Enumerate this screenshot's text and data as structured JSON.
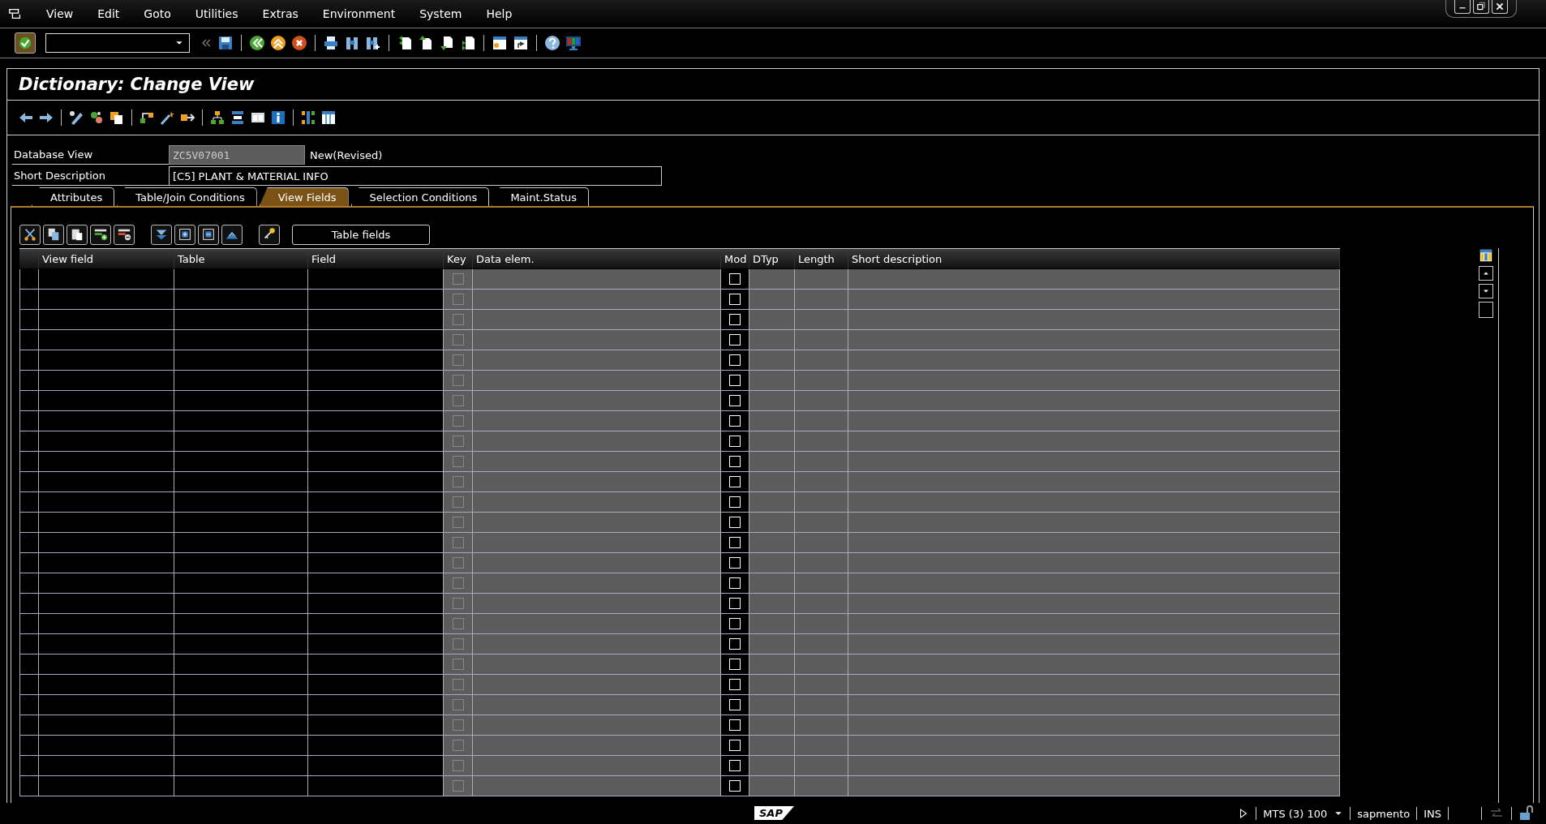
{
  "menu": [
    "View",
    "Edit",
    "Goto",
    "Utilities",
    "Extras",
    "Environment",
    "System",
    "Help"
  ],
  "title": "Dictionary: Change View",
  "fields": [
    {
      "label": "Database View",
      "value": "ZC5V07001",
      "kind": "readonly",
      "status": "New(Revised)"
    },
    {
      "label": "Short Description",
      "value": "[C5] PLANT & MATERIAL INFO",
      "kind": "input"
    }
  ],
  "tabs": [
    {
      "label": "Attributes",
      "selected": false
    },
    {
      "label": "Table/Join Conditions",
      "selected": false
    },
    {
      "label": "View Fields",
      "selected": true
    },
    {
      "label": "Selection Conditions",
      "selected": false
    },
    {
      "label": "Maint.Status",
      "selected": false
    }
  ],
  "table_toolbar": {
    "button": "Table fields"
  },
  "table": {
    "columns": [
      {
        "label": "View field",
        "editable": true
      },
      {
        "label": "Table",
        "editable": true
      },
      {
        "label": "Field",
        "editable": true
      },
      {
        "label": "Key",
        "editable": false,
        "kind": "checkbox"
      },
      {
        "label": "Data elem.",
        "editable": false
      },
      {
        "label": "Mod",
        "editable": true,
        "kind": "checkbox"
      },
      {
        "label": "DTyp",
        "editable": false
      },
      {
        "label": "Length",
        "editable": false
      },
      {
        "label": "Short description",
        "editable": false
      }
    ],
    "rows": [
      {
        "key_checked": false,
        "mod_checked": false
      },
      {
        "key_checked": false,
        "mod_checked": false
      },
      {
        "key_checked": false,
        "mod_checked": false
      },
      {
        "key_checked": false,
        "mod_checked": false
      },
      {
        "key_checked": false,
        "mod_checked": false
      },
      {
        "key_checked": false,
        "mod_checked": false
      },
      {
        "key_checked": false,
        "mod_checked": false
      },
      {
        "key_checked": false,
        "mod_checked": false
      },
      {
        "key_checked": false,
        "mod_checked": false
      },
      {
        "key_checked": false,
        "mod_checked": false
      },
      {
        "key_checked": false,
        "mod_checked": false
      },
      {
        "key_checked": false,
        "mod_checked": false
      },
      {
        "key_checked": false,
        "mod_checked": false
      },
      {
        "key_checked": false,
        "mod_checked": false
      },
      {
        "key_checked": false,
        "mod_checked": false
      },
      {
        "key_checked": false,
        "mod_checked": false
      },
      {
        "key_checked": false,
        "mod_checked": false
      },
      {
        "key_checked": false,
        "mod_checked": false
      },
      {
        "key_checked": false,
        "mod_checked": false
      },
      {
        "key_checked": false,
        "mod_checked": false
      },
      {
        "key_checked": false,
        "mod_checked": false
      },
      {
        "key_checked": false,
        "mod_checked": false
      },
      {
        "key_checked": false,
        "mod_checked": false
      },
      {
        "key_checked": false,
        "mod_checked": false
      },
      {
        "key_checked": false,
        "mod_checked": false
      },
      {
        "key_checked": false,
        "mod_checked": false
      }
    ]
  },
  "status_bar": {
    "logo": "SAP",
    "system": "MTS (3) 100",
    "user": "sapmento",
    "mode": "INS"
  }
}
